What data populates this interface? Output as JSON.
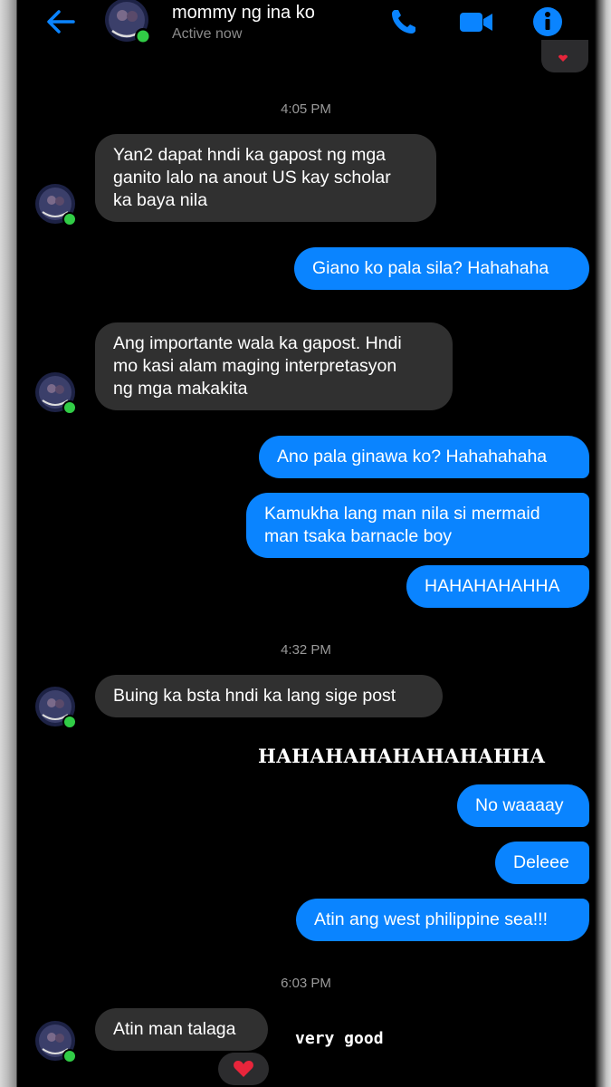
{
  "colors": {
    "accent": "#0a84ff",
    "incoming_bubble": "#303030",
    "background": "#000000",
    "online": "#31cc46",
    "heart": "#e8253b"
  },
  "header": {
    "contact_name": "mommy ng ina ko",
    "status": "Active now",
    "icons": [
      "back-arrow-icon",
      "phone-icon",
      "video-camera-icon",
      "info-icon"
    ]
  },
  "messages": [
    {
      "type": "time",
      "text": "4:05 PM"
    },
    {
      "type": "in",
      "text": "Yan2 dapat hndi ka gapost ng mga\nganito lalo na anout US kay scholar\nka baya nila"
    },
    {
      "type": "out",
      "text": "Giano ko pala sila? Hahahaha"
    },
    {
      "type": "in",
      "text": "Ang importante wala ka gapost. Hndi\nmo kasi alam maging interpretasyon\nng mga makakita"
    },
    {
      "type": "out",
      "text": "Ano pala ginawa ko? Hahahahaha"
    },
    {
      "type": "out",
      "text": "Kamukha lang man nila si mermaid\nman tsaka barnacle boy"
    },
    {
      "type": "out",
      "text": "HAHAHAHAHHA"
    },
    {
      "type": "time",
      "text": "4:32 PM"
    },
    {
      "type": "in",
      "text": "Buing ka bsta hndi ka lang sige post"
    },
    {
      "type": "out",
      "text": "No waaaay"
    },
    {
      "type": "out",
      "text": "Deleee"
    },
    {
      "type": "out",
      "text": "Atin ang west philippine sea!!!"
    },
    {
      "type": "time",
      "text": "6:03 PM"
    },
    {
      "type": "in",
      "text": "Atin man talaga"
    }
  ],
  "overlays": {
    "big_text": "HAHAHAHAHAHAHAHHA",
    "small_text": "very good"
  },
  "reaction": "heart"
}
